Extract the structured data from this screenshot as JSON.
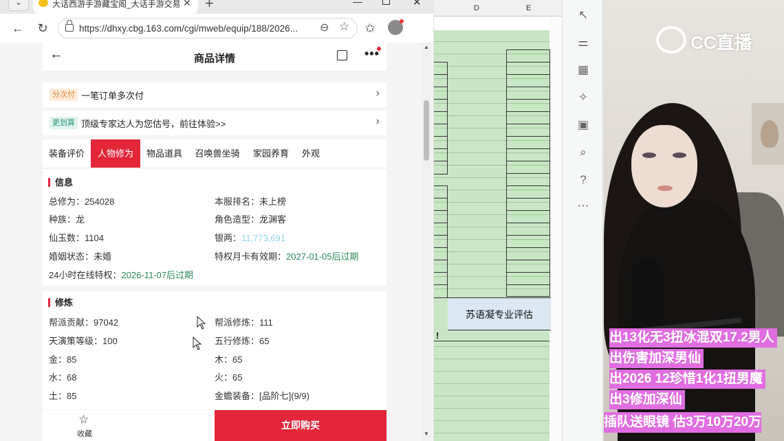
{
  "browser": {
    "tab_title": "大话西游手游藏宝阁_大话手游交易",
    "url": "https://dhxy.cbg.163.com/cgi/mweb/equip/188/2026..."
  },
  "page": {
    "title": "商品详情",
    "promo1": {
      "tag": "分次付",
      "text": "一笔订单多次付"
    },
    "promo2": {
      "tag": "更划算",
      "text": "顶级专家达人为您估号，前往体验>>"
    },
    "tabs": [
      "装备评价",
      "人物修为",
      "物品道具",
      "召唤兽坐骑",
      "家园养育",
      "外观"
    ],
    "active_tab": 1,
    "info": {
      "title": "信息",
      "left": [
        {
          "label": "总修为：",
          "value": "254028"
        },
        {
          "label": "种族：",
          "value": "龙"
        },
        {
          "label": "仙玉数：",
          "value": "1104"
        },
        {
          "label": "婚姻状态：",
          "value": "未婚"
        },
        {
          "label": "24小时在线特权：",
          "value": "2026-11-07后过期"
        }
      ],
      "right": [
        {
          "label": "本服排名：",
          "value": "未上榜"
        },
        {
          "label": "角色造型：",
          "value": "龙渊客"
        },
        {
          "label": "银两：",
          "value": "11,773,691"
        },
        {
          "label": "特权月卡有效期：",
          "value": "2027-01-05后过期"
        }
      ]
    },
    "cultivation": {
      "title": "修炼",
      "left": [
        {
          "label": "帮派贡献：",
          "value": "97042"
        },
        {
          "label": "天演策等级：",
          "value": "100"
        },
        {
          "label": "金：",
          "value": "85"
        },
        {
          "label": "水：",
          "value": "68"
        },
        {
          "label": "土：",
          "value": "85"
        }
      ],
      "right": [
        {
          "label": "帮派修炼：",
          "value": "111"
        },
        {
          "label": "五行修炼：",
          "value": "65"
        },
        {
          "label": "木：",
          "value": "65"
        },
        {
          "label": "火：",
          "value": "65"
        },
        {
          "label": "金蟾装备：",
          "value": "[品阶七](9/9)"
        }
      ]
    },
    "bottom": {
      "favorite": "收藏",
      "buy": "立即购买"
    }
  },
  "sheet": {
    "col_d": "D",
    "col_e": "E",
    "cell_text": "苏语凝专业评估",
    "mark": "!"
  },
  "stream": {
    "logo": "CC直播",
    "lines": [
      "出13化无3扭冰混双17.2男人",
      "出伤害加深男仙",
      "出2026 12珍惜1化1扭男魔",
      "出3修加深仙",
      "插队送眼镜  估3万10万20万"
    ]
  }
}
